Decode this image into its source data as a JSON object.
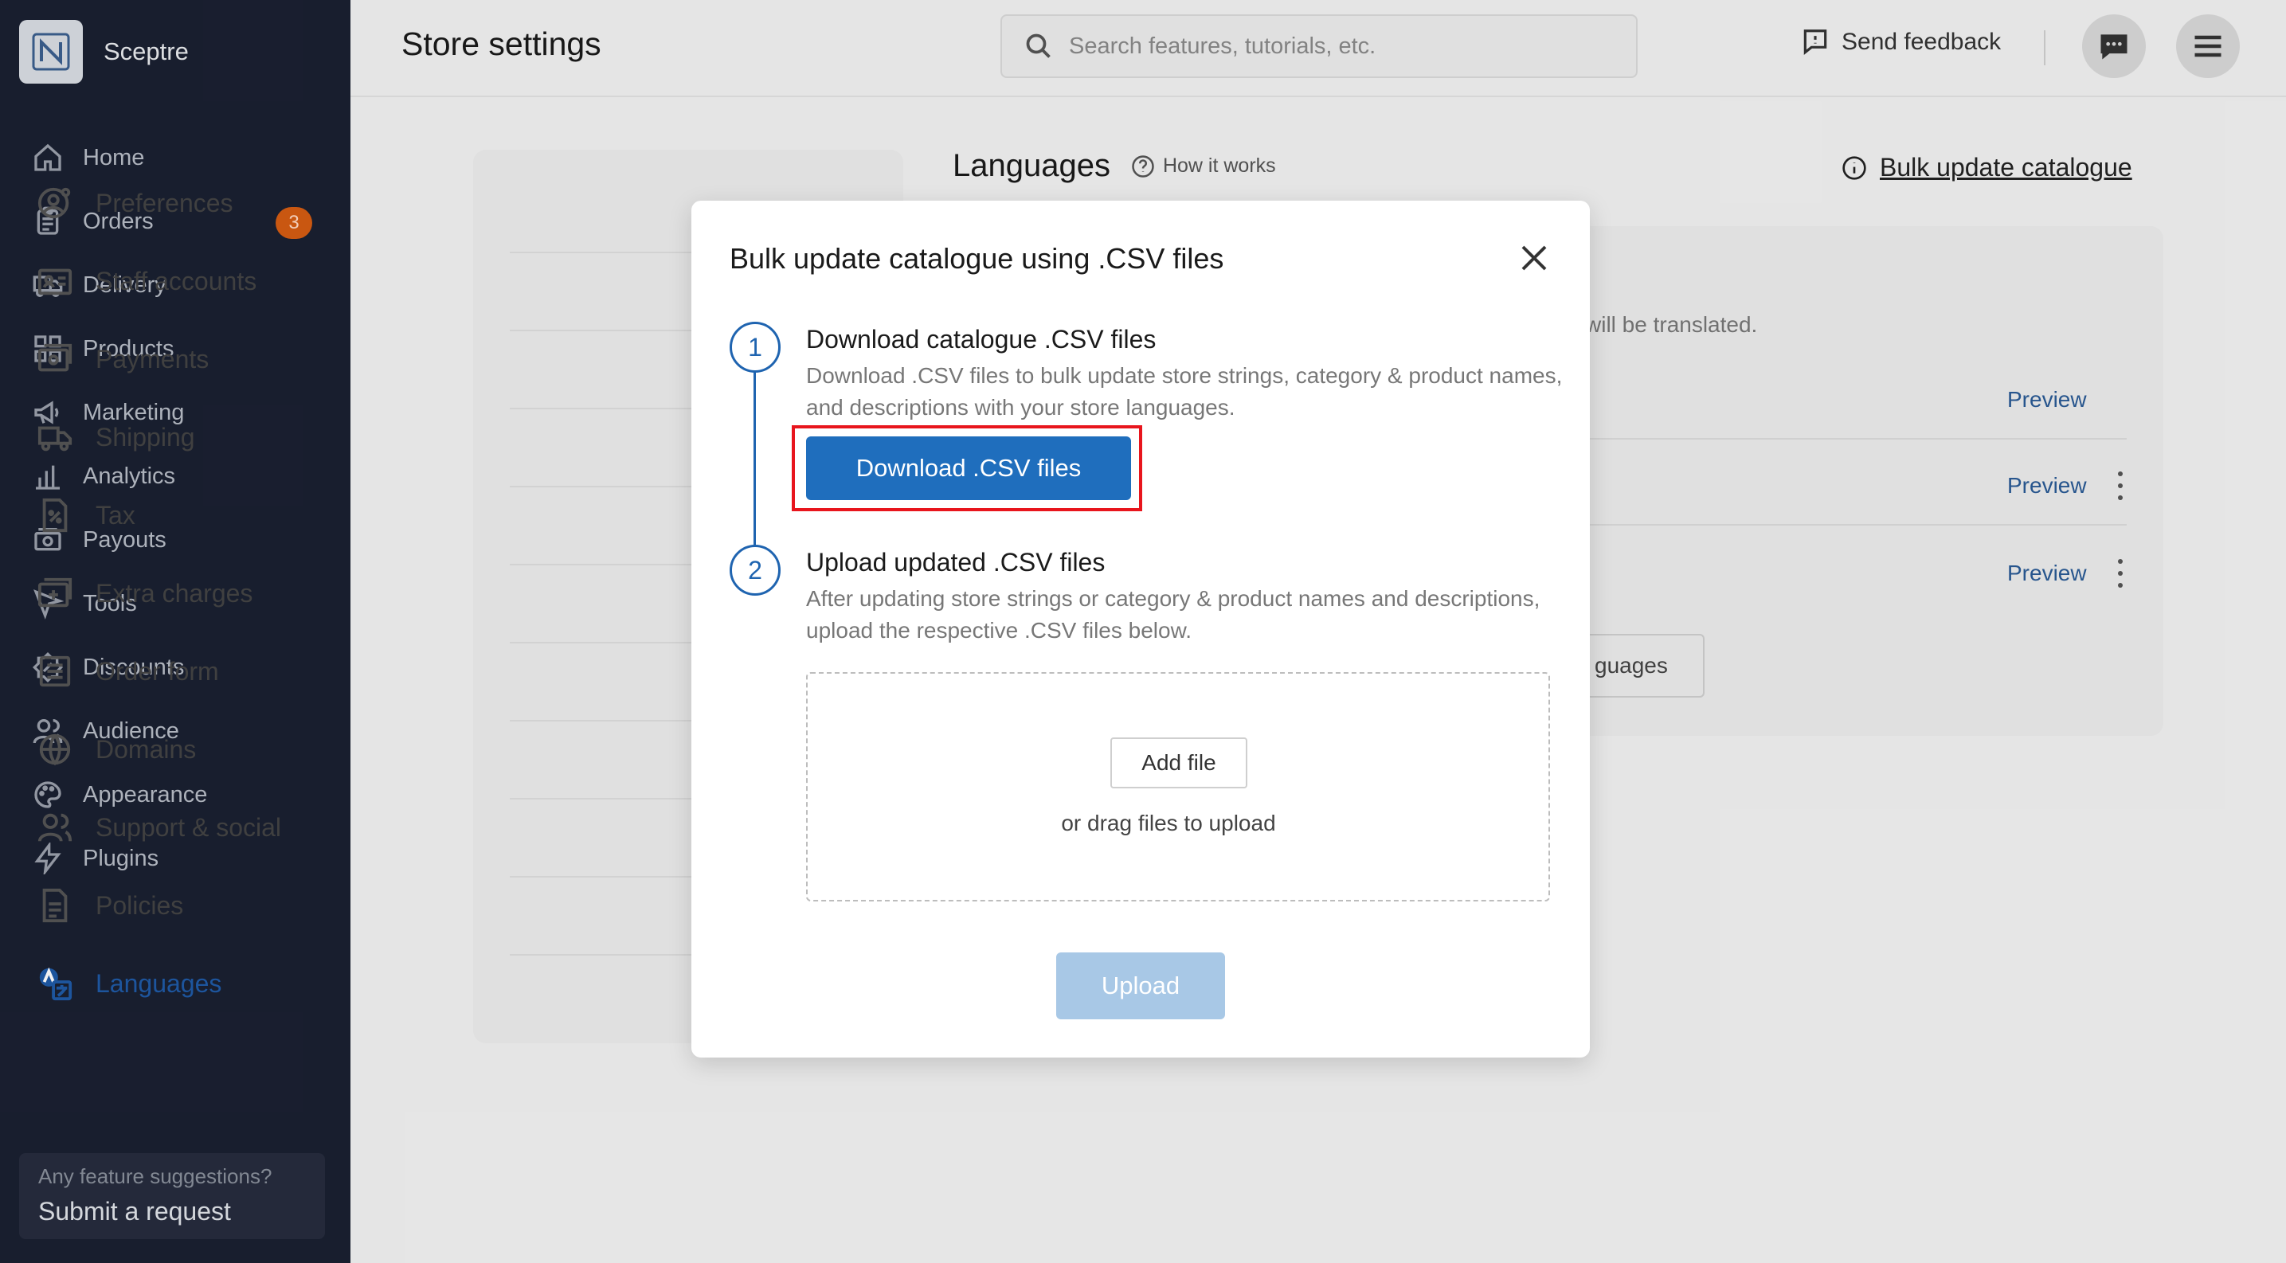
{
  "brand": {
    "name": "Sceptre"
  },
  "sidebar": {
    "items": [
      {
        "label": "Home",
        "icon": "home-icon"
      },
      {
        "label": "Orders",
        "icon": "clipboard-icon",
        "badge": "3"
      },
      {
        "label": "Delivery",
        "icon": "truck-icon"
      },
      {
        "label": "Products",
        "icon": "grid-icon"
      },
      {
        "label": "Marketing",
        "icon": "megaphone-icon"
      },
      {
        "label": "Analytics",
        "icon": "bar-chart-icon"
      },
      {
        "label": "Payouts",
        "icon": "cash-icon"
      },
      {
        "label": "Tools",
        "icon": "cursor-icon"
      },
      {
        "label": "Discounts",
        "icon": "discount-icon"
      },
      {
        "label": "Audience",
        "icon": "users-icon"
      },
      {
        "label": "Appearance",
        "icon": "palette-icon"
      },
      {
        "label": "Plugins",
        "icon": "bolt-icon"
      }
    ],
    "suggest_question": "Any feature suggestions?",
    "suggest_link": "Submit a request"
  },
  "header": {
    "title": "Store settings",
    "search_placeholder": "Search features, tutorials, etc.",
    "feedback_label": "Send feedback"
  },
  "settings_nav": {
    "items": [
      {
        "label": "Preferences",
        "icon": "user-gear-icon"
      },
      {
        "label": "Staff accounts",
        "icon": "id-card-icon"
      },
      {
        "label": "Payments",
        "icon": "wallet-icon"
      },
      {
        "label": "Shipping",
        "icon": "truck-icon"
      },
      {
        "label": "Tax",
        "icon": "percent-doc-icon"
      },
      {
        "label": "Extra charges",
        "icon": "plus-card-icon"
      },
      {
        "label": "Order form",
        "icon": "form-icon"
      },
      {
        "label": "Domains",
        "icon": "globe-icon"
      },
      {
        "label": "Support & social",
        "icon": "users-icon"
      },
      {
        "label": "Policies",
        "icon": "document-icon"
      },
      {
        "label": "Languages",
        "icon": "translate-icon",
        "active": true
      }
    ]
  },
  "content": {
    "title": "Languages",
    "how_it_works": "How it works",
    "bulk_link": "Bulk update catalogue",
    "desc_fragment": "will be translated.",
    "preview_label": "Preview",
    "languages_button_fragment": "guages"
  },
  "modal": {
    "title": "Bulk update catalogue using .CSV files",
    "step1": {
      "number": "1",
      "title": "Download catalogue .CSV files",
      "desc": "Download .CSV files to bulk update store strings, category & product names, and descriptions with your store languages.",
      "button": "Download .CSV files"
    },
    "step2": {
      "number": "2",
      "title": "Upload updated .CSV files",
      "desc": "After updating store strings or category & product names and descriptions, upload the respective .CSV files below.",
      "add_file": "Add file",
      "drag_text": "or drag files to upload"
    },
    "upload_button": "Upload"
  },
  "colors": {
    "sidebar_bg": "#1a2031",
    "primary": "#1f6ebd",
    "highlight": "#e8151d",
    "badge": "#d45c12"
  }
}
